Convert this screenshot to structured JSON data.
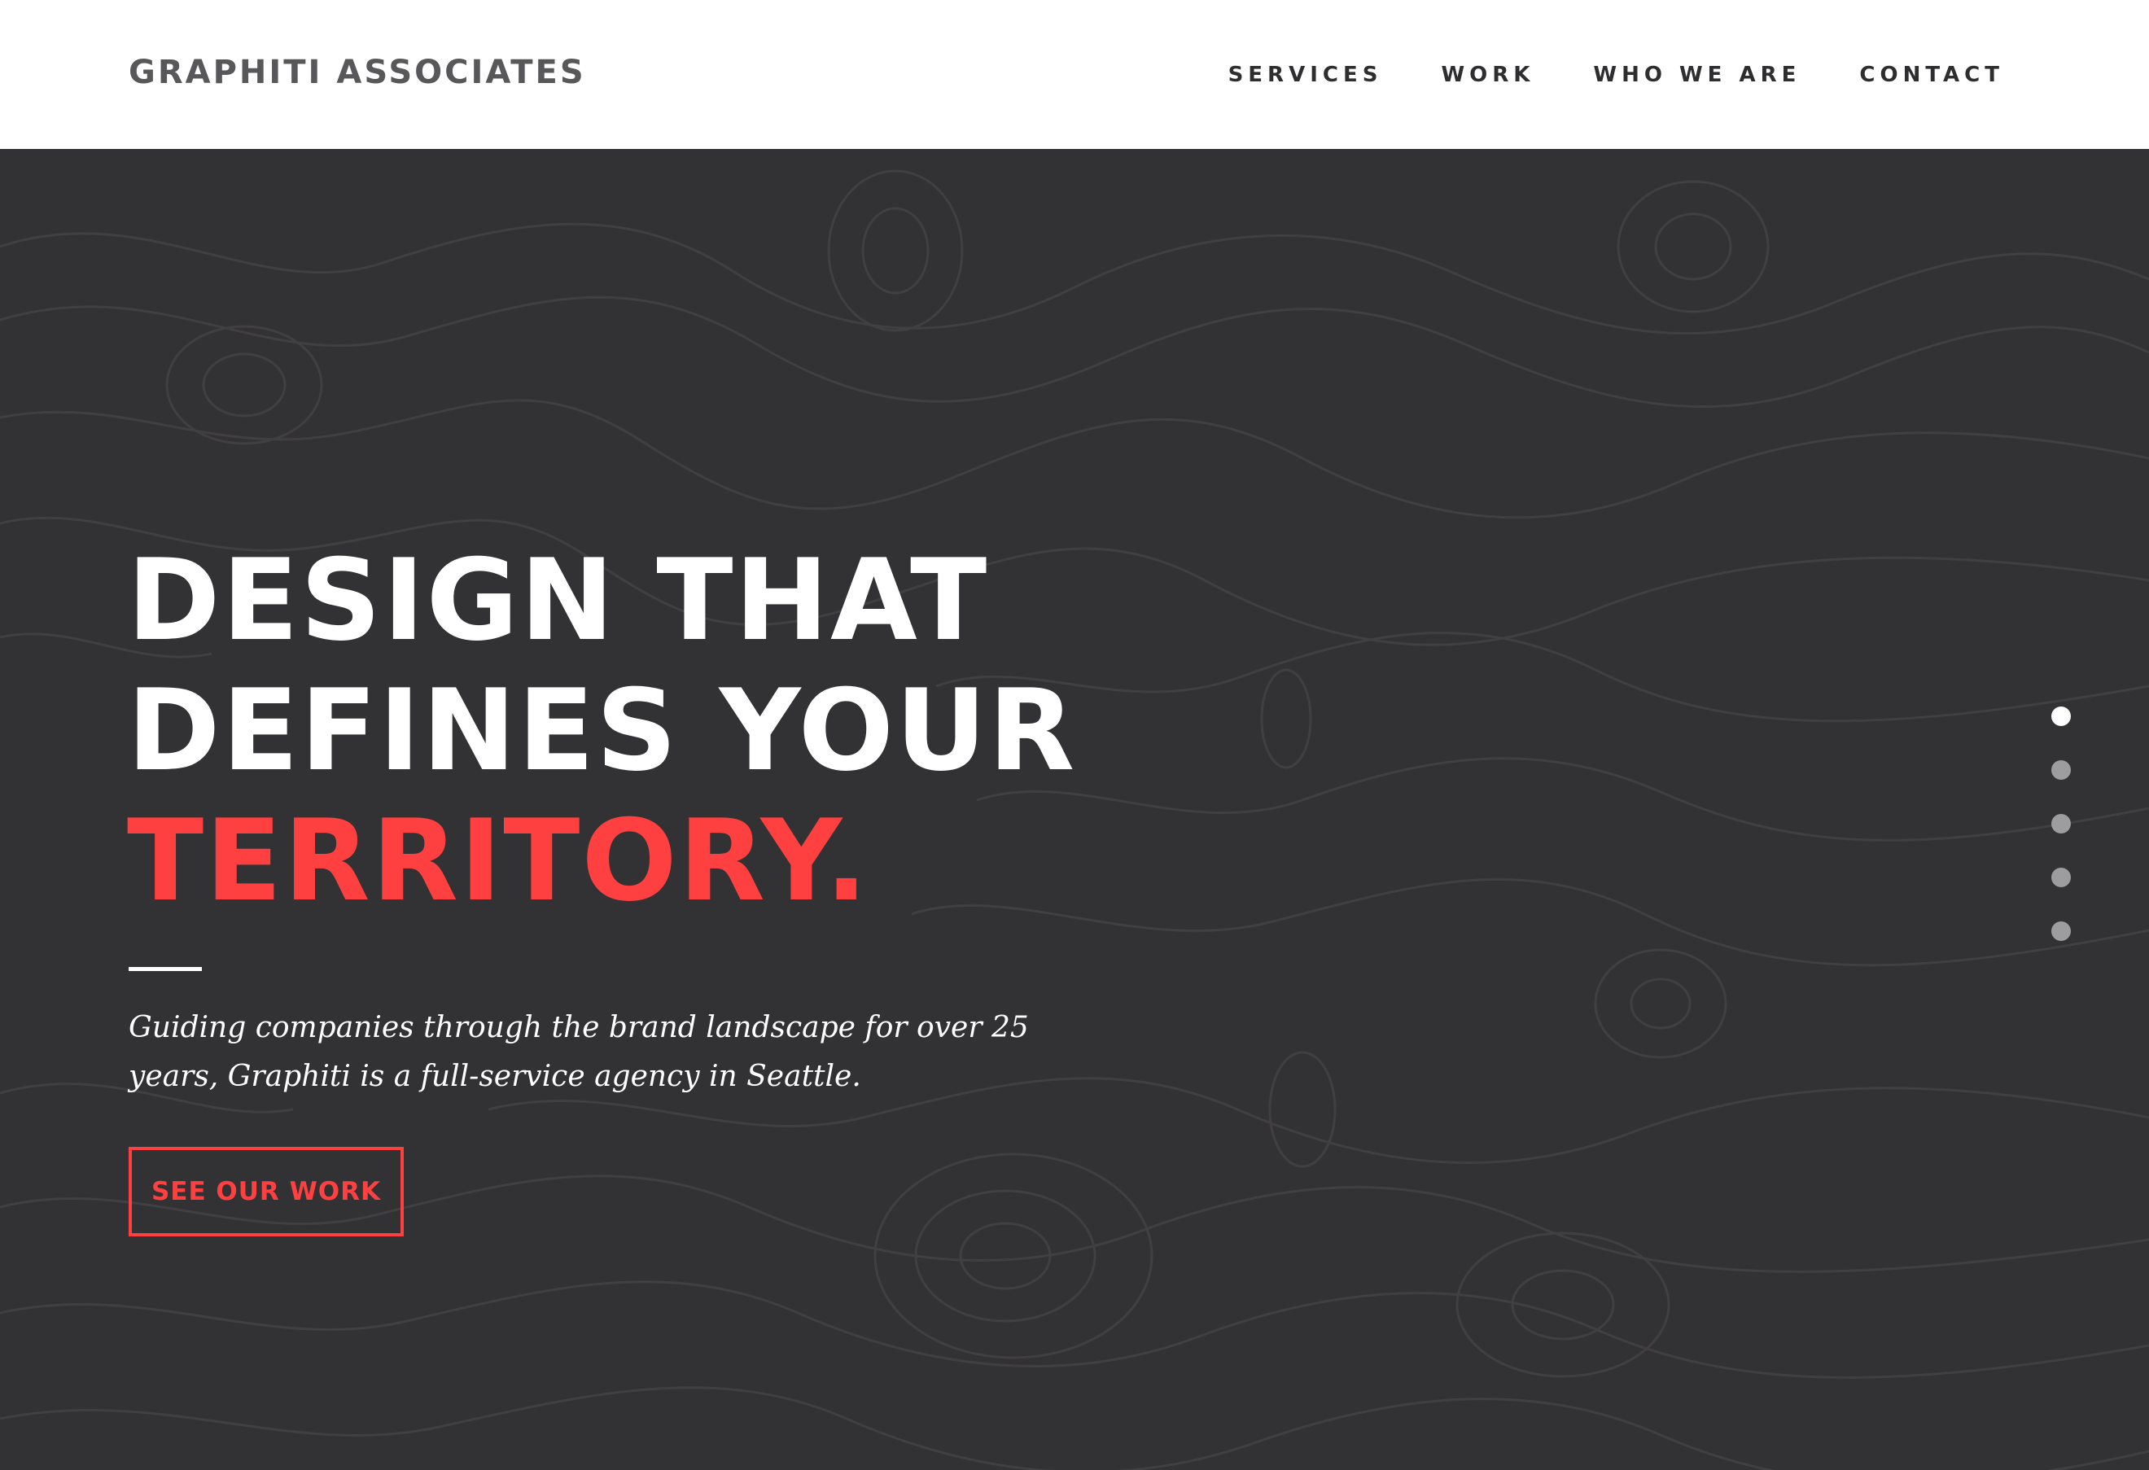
{
  "brand": {
    "logo": "GRAPHITI ASSOCIATES"
  },
  "nav": {
    "items": [
      {
        "label": "SERVICES"
      },
      {
        "label": "WORK"
      },
      {
        "label": "WHO WE ARE"
      },
      {
        "label": "CONTACT"
      }
    ]
  },
  "hero": {
    "headline": {
      "line1": "DESIGN THAT",
      "line2": "DEFINES YOUR",
      "line3": "TERRITORY."
    },
    "intro": "Guiding companies through the brand landscape for over 25 years, Graphiti is a full-service agency in Seattle.",
    "cta_label": "SEE OUR WORK"
  },
  "slides": {
    "count": 5,
    "active_index": 0
  },
  "colors": {
    "background": "#323133",
    "header": "#ffffff",
    "accent": "#ff4040",
    "contour": "#413f42",
    "text_light": "#ffffff",
    "nav_text": "#2e2e30",
    "logo_text": "#58585a",
    "dot_inactive": "#9d9c9e"
  }
}
